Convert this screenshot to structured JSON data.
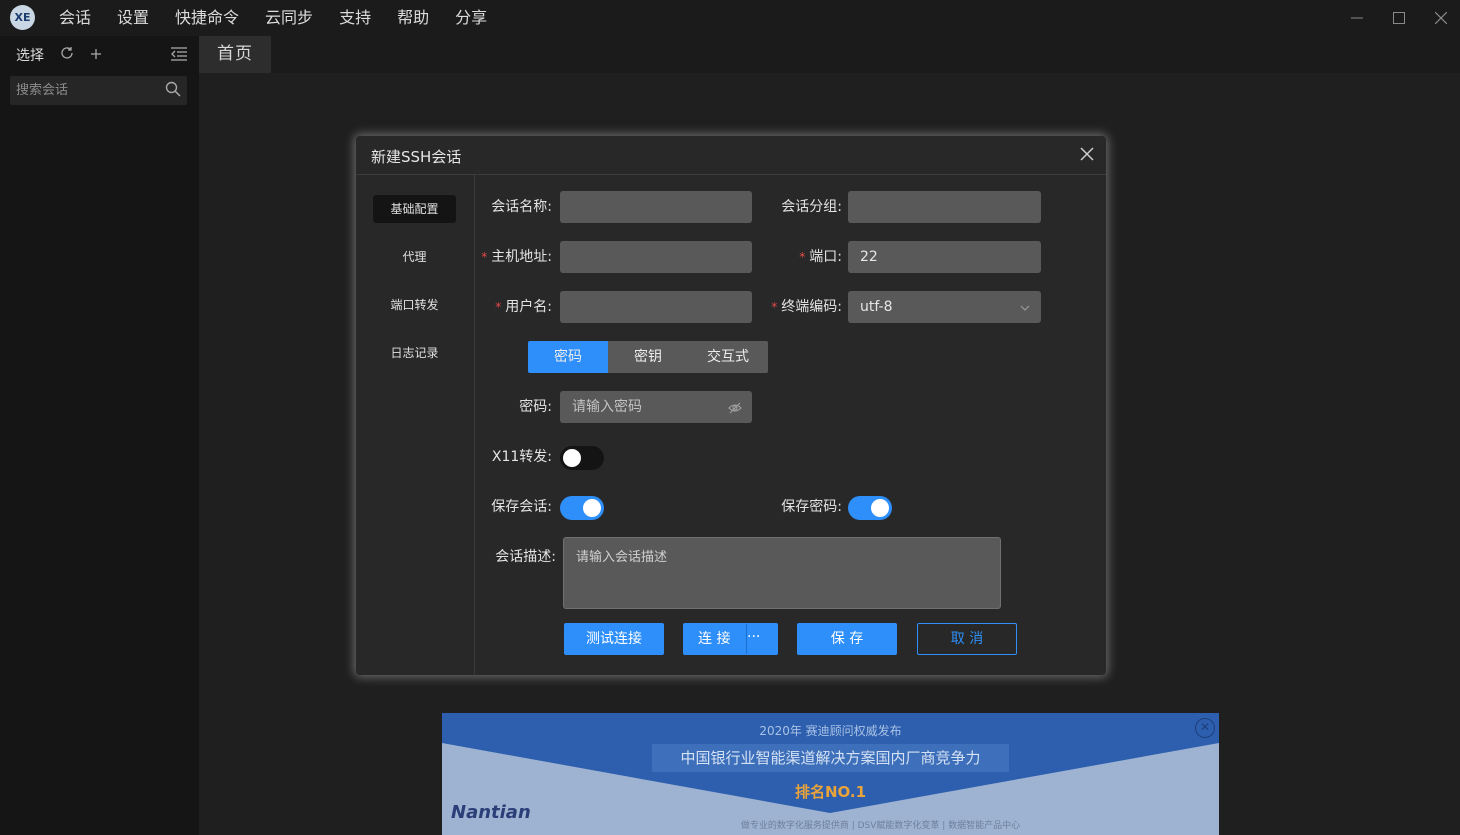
{
  "app": {
    "logo": "XE",
    "menu": [
      "会话",
      "设置",
      "快捷命令",
      "云同步",
      "支持",
      "帮助",
      "分享"
    ],
    "window_controls": [
      "minimize-icon",
      "maximize-icon",
      "close-icon"
    ]
  },
  "sidebar": {
    "title": "选择",
    "search_placeholder": "搜索会话"
  },
  "tabs": [
    {
      "label": "首页"
    }
  ],
  "dialog": {
    "title": "新建SSH会话",
    "nav": [
      "基础配置",
      "代理",
      "端口转发",
      "日志记录"
    ],
    "active_nav": "基础配置",
    "fields": {
      "session_name_label": "会话名称:",
      "session_name_value": "",
      "session_group_label": "会话分组:",
      "session_group_value": "",
      "host_label": "主机地址:",
      "host_value": "",
      "port_label": "端口:",
      "port_value": "22",
      "username_label": "用户名:",
      "username_value": "",
      "encoding_label": "终端编码:",
      "encoding_value": "utf-8",
      "password_label": "密码:",
      "password_placeholder": "请输入密码",
      "x11_label": "X11转发:",
      "save_session_label": "保存会话:",
      "save_password_label": "保存密码:",
      "desc_label": "会话描述:",
      "desc_placeholder": "请输入会话描述"
    },
    "required_marker": "*",
    "auth_modes": [
      "密码",
      "密钥",
      "交互式"
    ],
    "active_auth_mode": "密码",
    "toggles": {
      "x11_forwarding": false,
      "save_session": true,
      "save_password": true
    },
    "buttons": {
      "test": "测试连接",
      "connect": "连 接",
      "connect_more": "···",
      "save": "保 存",
      "cancel": "取 消"
    }
  },
  "ad": {
    "line1": "2020年 赛迪顾问权威发布",
    "line2": "中国银行业智能渠道解决方案国内厂商竞争力",
    "line3": "排名NO.1",
    "brand": "Nantian",
    "footer": "做专业的数字化服务提供商  |  DSV赋能数字化变革  |  数据智能产品中心"
  },
  "colors": {
    "accent": "#2e8ffa",
    "required": "#e84a4a",
    "dialog_bg": "#282828",
    "input_bg": "#595959"
  }
}
